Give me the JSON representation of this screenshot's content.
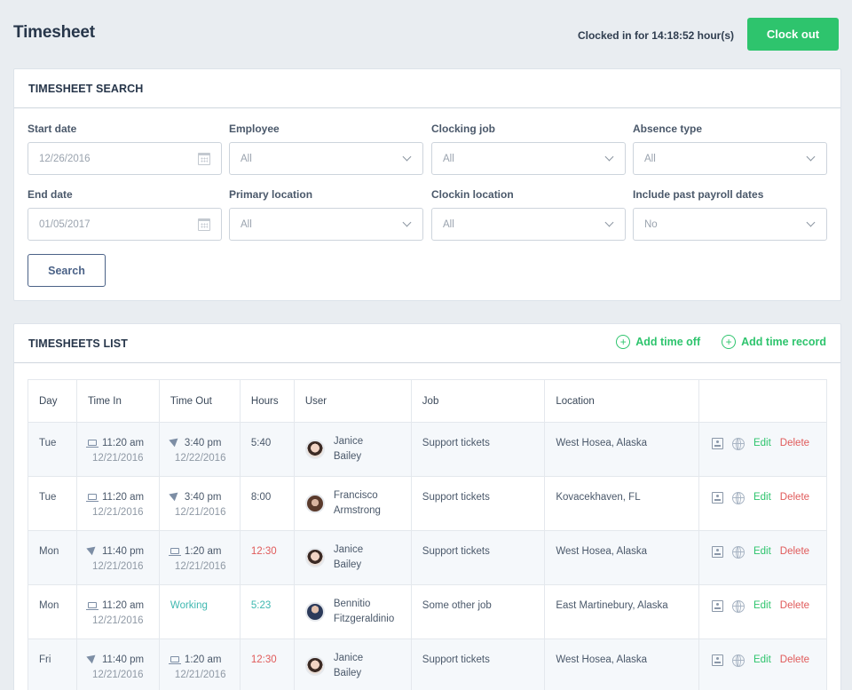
{
  "header": {
    "title": "Timesheet",
    "clock_status": "Clocked in for 14:18:52 hour(s)",
    "clock_out_label": "Clock out"
  },
  "search": {
    "title": "TIMESHEET SEARCH",
    "fields": {
      "start_date": {
        "label": "Start date",
        "value": "12/26/2016"
      },
      "end_date": {
        "label": "End date",
        "value": "01/05/2017"
      },
      "employee": {
        "label": "Employee",
        "value": "All"
      },
      "primary_location": {
        "label": "Primary location",
        "value": "All"
      },
      "clocking_job": {
        "label": "Clocking job",
        "value": "All"
      },
      "clockin_location": {
        "label": "Clockin location",
        "value": "All"
      },
      "absence_type": {
        "label": "Absence type",
        "value": "All"
      },
      "include_past_payroll": {
        "label": "Include past payroll dates",
        "value": "No"
      }
    },
    "search_label": "Search"
  },
  "list": {
    "title": "TIMESHEETS LIST",
    "add_time_off_label": "Add time off",
    "add_time_record_label": "Add time record",
    "columns": [
      "Day",
      "Time In",
      "Time Out",
      "Hours",
      "User",
      "Job",
      "Location",
      ""
    ],
    "action_labels": {
      "edit": "Edit",
      "delete": "Delete"
    },
    "rows": [
      {
        "day": "Tue",
        "time_in": "11:20 am",
        "time_in_date": "12/21/2016",
        "time_in_icon": "laptop-icon",
        "time_out": "3:40 pm",
        "time_out_date": "12/22/2016",
        "time_out_icon": "location-arrow-icon",
        "hours": "5:40",
        "hours_status": "normal",
        "user_first": "Janice",
        "user_last": "Bailey",
        "avatar": "janice",
        "job": "Support tickets",
        "location": "West Hosea, Alaska"
      },
      {
        "day": "Tue",
        "time_in": "11:20 am",
        "time_in_date": "12/21/2016",
        "time_in_icon": "laptop-icon",
        "time_out": "3:40 pm",
        "time_out_date": "12/21/2016",
        "time_out_icon": "location-arrow-icon",
        "hours": "8:00",
        "hours_status": "normal",
        "user_first": "Francisco",
        "user_last": "Armstrong",
        "avatar": "francisco",
        "job": "Support tickets",
        "location": "Kovacekhaven, FL"
      },
      {
        "day": "Mon",
        "time_in": "11:40 pm",
        "time_in_date": "12/21/2016",
        "time_in_icon": "location-arrow-icon",
        "time_out": "1:20 am",
        "time_out_date": "12/21/2016",
        "time_out_icon": "laptop-icon",
        "hours": "12:30",
        "hours_status": "overtime",
        "user_first": "Janice",
        "user_last": "Bailey",
        "avatar": "janice",
        "job": "Support tickets",
        "location": "West Hosea, Alaska"
      },
      {
        "day": "Mon",
        "time_in": "11:20 am",
        "time_in_date": "12/21/2016",
        "time_in_icon": "laptop-icon",
        "time_out": "Working",
        "time_out_date": "",
        "time_out_icon": "",
        "hours": "5:23",
        "hours_status": "working",
        "user_first": "Bennitio",
        "user_last": "Fitzgeraldinio",
        "avatar": "bennitio",
        "job": "Some other job",
        "location": "East Martinebury, Alaska"
      },
      {
        "day": "Fri",
        "time_in": "11:40 pm",
        "time_in_date": "12/21/2016",
        "time_in_icon": "location-arrow-icon",
        "time_out": "1:20 am",
        "time_out_date": "12/21/2016",
        "time_out_icon": "laptop-icon",
        "hours": "12:30",
        "hours_status": "overtime",
        "user_first": "Janice",
        "user_last": "Bailey",
        "avatar": "janice",
        "job": "Support tickets",
        "location": "West Hosea, Alaska"
      }
    ]
  },
  "colors": {
    "accent_green": "#2ec46d",
    "danger_red": "#e05a5a",
    "working_teal": "#3fb8b0",
    "background": "#e9edf1"
  }
}
